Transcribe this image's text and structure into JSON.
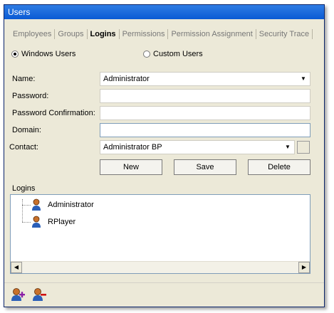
{
  "window": {
    "title": "Users"
  },
  "tabs": [
    {
      "label": "Employees",
      "active": false
    },
    {
      "label": "Groups",
      "active": false
    },
    {
      "label": "Logins",
      "active": true
    },
    {
      "label": "Permissions",
      "active": false
    },
    {
      "label": "Permission Assignment",
      "active": false
    },
    {
      "label": "Security Trace",
      "active": false
    }
  ],
  "user_type": {
    "windows_label": "Windows Users",
    "custom_label": "Custom Users",
    "selected": "windows"
  },
  "form": {
    "name_label": "Name:",
    "name_value": "Administrator",
    "password_label": "Password:",
    "password_value": "",
    "password_confirm_label": "Password Confirmation:",
    "password_confirm_value": "",
    "domain_label": "Domain:",
    "domain_value": "",
    "contact_label": "Contact:",
    "contact_value": "Administrator BP"
  },
  "buttons": {
    "new_label": "New",
    "save_label": "Save",
    "delete_label": "Delete"
  },
  "logins": {
    "header": "Logins",
    "items": [
      "Administrator",
      "RPlayer"
    ]
  },
  "icons": {
    "add": "add-user-icon",
    "remove": "remove-user-icon",
    "user": "user-icon"
  }
}
